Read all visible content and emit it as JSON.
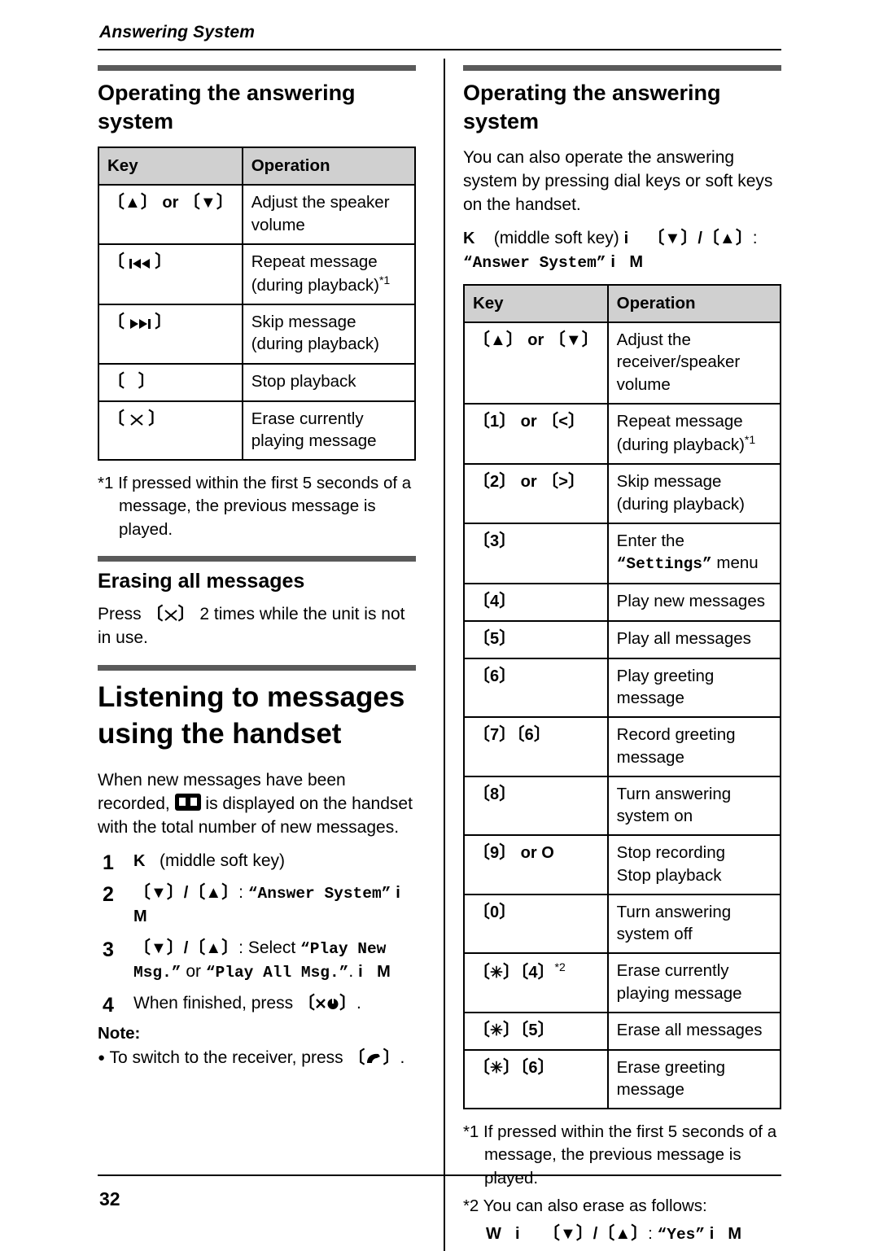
{
  "running_head": "Answering System",
  "page_number": "32",
  "left": {
    "section_title": "Operating the answering system",
    "table": {
      "headers": [
        "Key",
        "Operation"
      ],
      "rows": [
        {
          "key": "[▲] or [▼]",
          "op": "Adjust the speaker volume"
        },
        {
          "key": "[◀◀]",
          "op": "Repeat message (during playback)*1"
        },
        {
          "key": "[▶▶]",
          "op": "Skip message (during playback)"
        },
        {
          "key": "[ ]",
          "op": "Stop playback"
        },
        {
          "key": "[✕]",
          "op": "Erase currently playing message"
        }
      ]
    },
    "footnote1": "*1 If pressed within the first 5 seconds of a message, the previous message is played.",
    "erasing_title": "Erasing all messages",
    "erasing_body_a": "Press ",
    "erasing_key": "[✕]",
    "erasing_body_b": " 2 times while the unit is not in use.",
    "big_title": "Listening to messages using the handset",
    "intro_a": "When new messages have been recorded, ",
    "intro_b": " is displayed on the handset with the total number of new messages.",
    "steps": [
      {
        "num": "1",
        "text": "K    (middle soft key)"
      },
      {
        "num": "2",
        "text": "[▼]/[▲]: “Answer System” i M"
      },
      {
        "num": "3",
        "text": "[▼]/[▲]: Select “Play New Msg.” or “Play All Msg.”. i  M"
      },
      {
        "num": "4",
        "text": "When finished, press [☎⏻]."
      }
    ],
    "note_label": "Note:",
    "note_text": "To switch to the receiver, press [✆]."
  },
  "right": {
    "section_title": "Operating the answering system",
    "intro": "You can also operate the answering system by pressing dial keys or soft keys on the handset.",
    "line_keys": "K    (middle soft key) i    [▼]/[▲]:",
    "line_keys_2": "“Answer System” i    M",
    "table": {
      "headers": [
        "Key",
        "Operation"
      ],
      "rows": [
        {
          "key": "[▲] or [▼]",
          "op": "Adjust the receiver/speaker volume"
        },
        {
          "key": "[1] or [<]",
          "op": "Repeat message (during playback)*1"
        },
        {
          "key": "[2] or [>]",
          "op": "Skip message (during playback)"
        },
        {
          "key": "[3]",
          "op": "Enter the “Settings” menu"
        },
        {
          "key": "[4]",
          "op": "Play new messages"
        },
        {
          "key": "[5]",
          "op": "Play all messages"
        },
        {
          "key": "[6]",
          "op": "Play greeting message"
        },
        {
          "key": "[7][6]",
          "op": "Record greeting message"
        },
        {
          "key": "[8]",
          "op": "Turn answering system on"
        },
        {
          "key": "[9] or O",
          "op": "Stop recording Stop playback"
        },
        {
          "key": "[0]",
          "op": "Turn answering system off"
        },
        {
          "key": "[✳][4]*2",
          "op": "Erase currently playing message"
        },
        {
          "key": "[✳][5]",
          "op": "Erase all messages"
        },
        {
          "key": "[✳][6]",
          "op": "Erase greeting message"
        }
      ]
    },
    "footnote1": "*1 If pressed within the first 5 seconds of a message, the previous message is played.",
    "footnote2": "*2 You can also erase as follows:",
    "footnote2_line": "W    i     [▼]/[▲]: “Yes” i    M"
  }
}
